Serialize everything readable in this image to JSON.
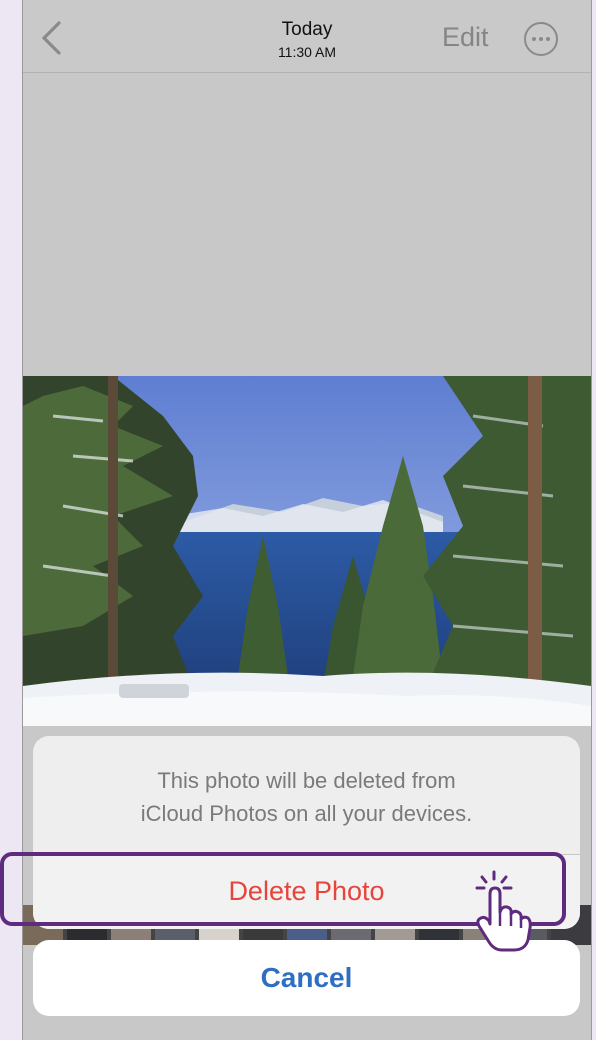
{
  "nav": {
    "title": "Today",
    "subtitle": "11:30 AM",
    "edit_label": "Edit",
    "back_icon": "chevron-left-icon",
    "more_icon": "ellipsis-circle-icon"
  },
  "action_sheet": {
    "message_line1": "This photo will be deleted from",
    "message_line2": "iCloud Photos on all your devices.",
    "delete_label": "Delete Photo",
    "cancel_label": "Cancel"
  },
  "colors": {
    "destructive": "#e5453a",
    "cancel": "#2f6fc1",
    "highlight": "#5e2b7e"
  }
}
